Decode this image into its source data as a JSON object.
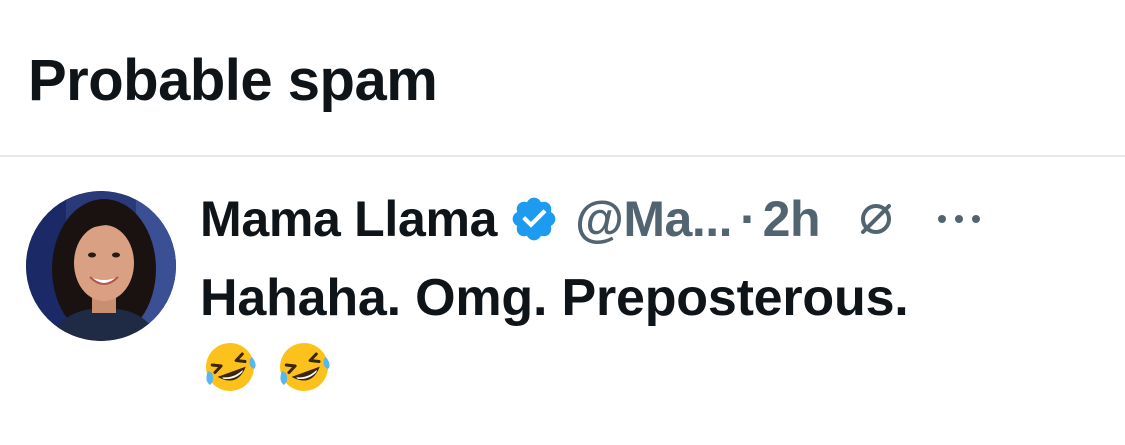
{
  "section": {
    "title": "Probable spam"
  },
  "post": {
    "author_name": "Mama Llama",
    "verified": true,
    "handle": "@Ma...",
    "separator": "·",
    "timestamp": "2h",
    "text": "Hahaha. Omg. Preposterous.",
    "emojis": [
      "rolling-on-floor-laughing",
      "rolling-on-floor-laughing"
    ],
    "icons": {
      "verified": "verified-badge-icon",
      "hidden": "circle-slash-icon",
      "more": "more-options-icon"
    }
  },
  "colors": {
    "text_primary": "#0f1419",
    "text_secondary": "#536471",
    "verified_blue": "#1d9bf0",
    "divider": "#e6e9ec"
  }
}
